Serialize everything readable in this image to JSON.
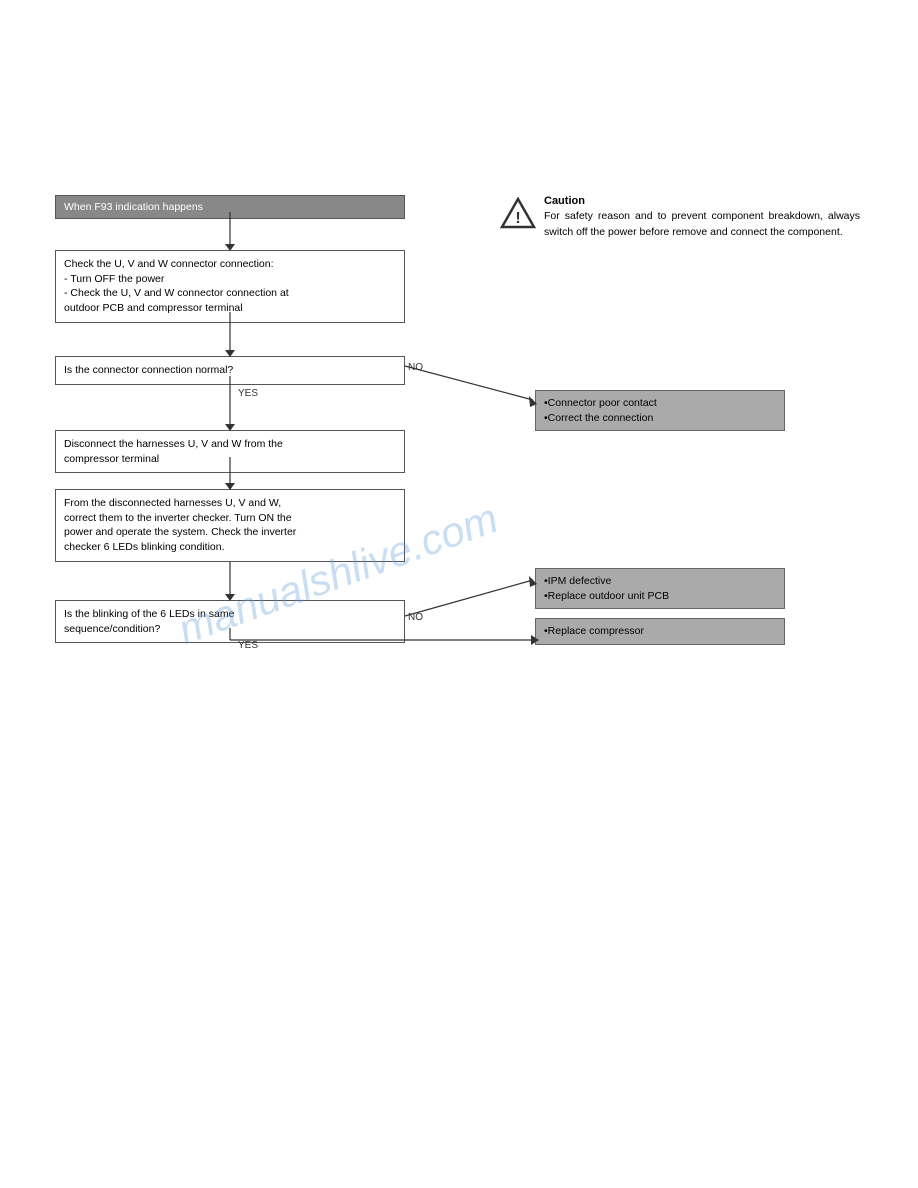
{
  "caution": {
    "label": "Caution",
    "text": "For safety reason and to prevent component breakdown, always switch off the power before remove and connect the component."
  },
  "flowchart": {
    "start_label": "When F93 indication happens",
    "box_check_label": "Check the U, V and W connector connection:\n - Turn OFF the power\n - Check the U, V and W connector connection at outdoor PCB and compressor terminal",
    "box_connector_question": "Is the connector connection normal?",
    "box_connector_no_label": "NO",
    "box_connector_yes_label": "YES",
    "box_disconnect_label": "Disconnect the harnesses U, V and W from the compressor terminal",
    "box_from_disconnected_label": "From the disconnected harnesses U, V and W, correct them to the inverter checker. Turn ON the power and operate the system. Check the inverter checker 6 LEDs blinking condition.",
    "box_blinking_question": "Is the blinking of the 6 LEDs in same sequence/condition?",
    "box_blinking_no_label": "NO",
    "box_blinking_yes_label": "YES",
    "result_connector_poor": "•Connector poor contact\n•Correct the connection",
    "result_ipm_defective": "•IPM defective\n•Replace outdoor unit PCB",
    "result_replace_compressor": "•Replace compressor",
    "watermark": "manualshlive.com"
  }
}
